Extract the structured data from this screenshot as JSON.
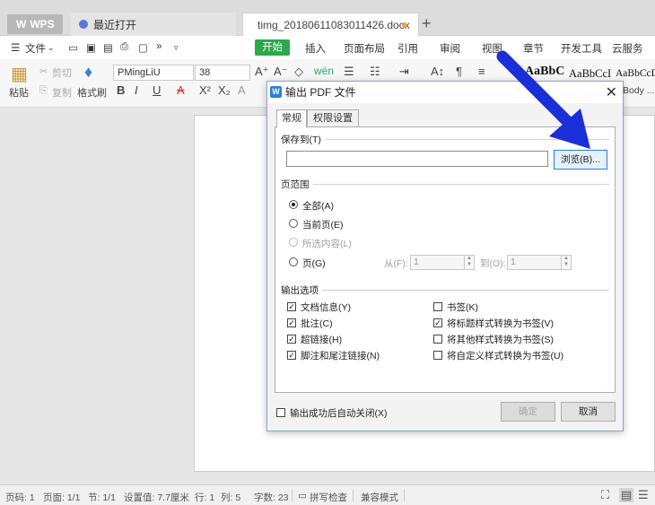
{
  "tabs": {
    "wps": "WPS",
    "recent": "最近打开",
    "doc": "timg_20180611083011426.docx",
    "new_tab": "+"
  },
  "menu": {
    "file": "文件",
    "items": [
      "开始",
      "插入",
      "页面布局",
      "引用",
      "审阅",
      "视图",
      "章节",
      "开发工具",
      "云服务"
    ]
  },
  "ribbon": {
    "paste": "粘贴",
    "cut": "剪切",
    "copy": "复制",
    "format_painter": "格式刷",
    "font_name": "PMingLiU",
    "font_size": "38",
    "style_samples": [
      "AaBbC",
      "AaBbCcI",
      "AaBbCcD"
    ],
    "body_style": "Body ..."
  },
  "dialog": {
    "title": "输出 PDF 文件",
    "tabs": [
      "常规",
      "权限设置"
    ],
    "save_to_label": "保存到(T)",
    "path_value": "",
    "browse_button": "浏览(B)...",
    "range_label": "页范围",
    "range_all": "全部(A)",
    "range_current": "当前页(E)",
    "range_selection": "所选内容(L)",
    "range_pages": "页(G)",
    "from_label": "从(F):",
    "from_value": "1",
    "to_label": "到(O):",
    "to_value": "1",
    "output_label": "输出选项",
    "options_left": [
      {
        "label": "文档信息(Y)",
        "checked": true
      },
      {
        "label": "批注(C)",
        "checked": true
      },
      {
        "label": "超链接(H)",
        "checked": true
      },
      {
        "label": "脚注和尾注链接(N)",
        "checked": true
      }
    ],
    "options_right": [
      {
        "label": "书签(K)",
        "checked": false
      },
      {
        "label": "将标题样式转换为书签(V)",
        "checked": true
      },
      {
        "label": "将其他样式转换为书签(S)",
        "checked": false
      },
      {
        "label": "将自定义样式转换为书签(U)",
        "checked": false
      }
    ],
    "auto_close": "输出成功后自动关闭(X)",
    "ok_button": "确定",
    "cancel_button": "取消"
  },
  "status": {
    "page": "页码: 1",
    "pages": "页面: 1/1",
    "section": "节: 1/1",
    "setting": "设置值: 7.7厘米",
    "row": "行: 1",
    "col": "列: 5",
    "words": "字数: 23",
    "spell": "拼写检查",
    "compat": "兼容模式"
  },
  "colors": {
    "accent_green": "#2ba84a",
    "arrow_blue": "#1a2fd8",
    "dialog_logo": "#2c7fe0"
  }
}
